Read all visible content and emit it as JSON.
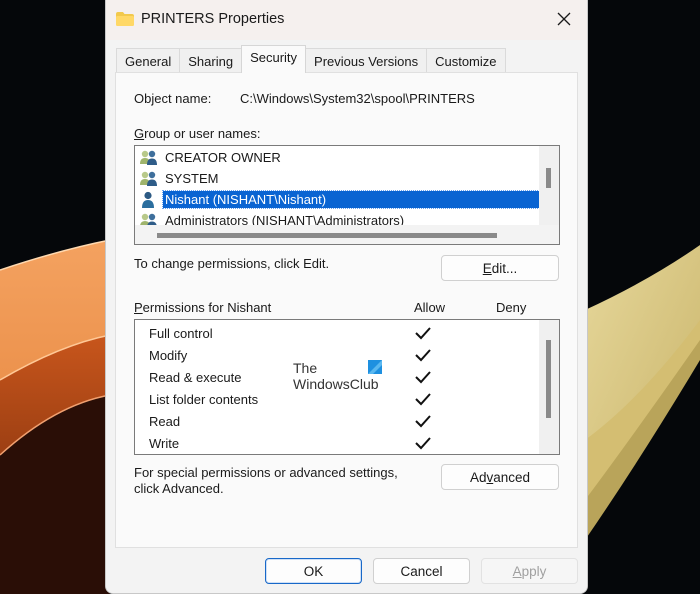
{
  "window": {
    "title": "PRINTERS Properties",
    "icon": "folder-icon",
    "close_icon": "close-icon"
  },
  "tabs": [
    {
      "label": "General",
      "active": false
    },
    {
      "label": "Sharing",
      "active": false
    },
    {
      "label": "Security",
      "active": true
    },
    {
      "label": "Previous Versions",
      "active": false
    },
    {
      "label": "Customize",
      "active": false
    }
  ],
  "security": {
    "object_name_label": "Object name:",
    "object_name_value": "C:\\Windows\\System32\\spool\\PRINTERS",
    "group_label_accel": "G",
    "group_label_rest": "roup or user names:",
    "users": [
      {
        "name": "CREATOR OWNER",
        "icon": "user-group-icon",
        "selected": false
      },
      {
        "name": "SYSTEM",
        "icon": "user-group-icon",
        "selected": false
      },
      {
        "name": "Nishant (NISHANT\\Nishant)",
        "icon": "user-icon",
        "selected": true
      },
      {
        "name": "Administrators (NISHANT\\Administrators)",
        "icon": "user-group-icon",
        "selected": false
      }
    ],
    "change_hint": "To change permissions, click Edit.",
    "edit_button_accel": "E",
    "edit_button_rest": "dit...",
    "permissions_label_accel": "P",
    "permissions_label_rest": "ermissions for Nishant",
    "allow_header": "Allow",
    "deny_header": "Deny",
    "permissions": [
      {
        "name": "Full control",
        "allow": true,
        "deny": false
      },
      {
        "name": "Modify",
        "allow": true,
        "deny": false
      },
      {
        "name": "Read & execute",
        "allow": true,
        "deny": false
      },
      {
        "name": "List folder contents",
        "allow": true,
        "deny": false
      },
      {
        "name": "Read",
        "allow": true,
        "deny": false
      },
      {
        "name": "Write",
        "allow": true,
        "deny": false
      }
    ],
    "advanced_hint_line1": "For special permissions or advanced settings,",
    "advanced_hint_line2": "click Advanced.",
    "advanced_button_pre": "Ad",
    "advanced_button_accel": "v",
    "advanced_button_post": "anced"
  },
  "watermark": {
    "line1": "The",
    "line2": "WindowsClub",
    "logo_color": "#1e90e0"
  },
  "footer": {
    "ok_label": "OK",
    "cancel_label": "Cancel",
    "apply_accel": "A",
    "apply_rest": "pply",
    "apply_enabled": false
  },
  "colors": {
    "selection": "#0a64d2",
    "default_button_border": "#1868c8"
  }
}
